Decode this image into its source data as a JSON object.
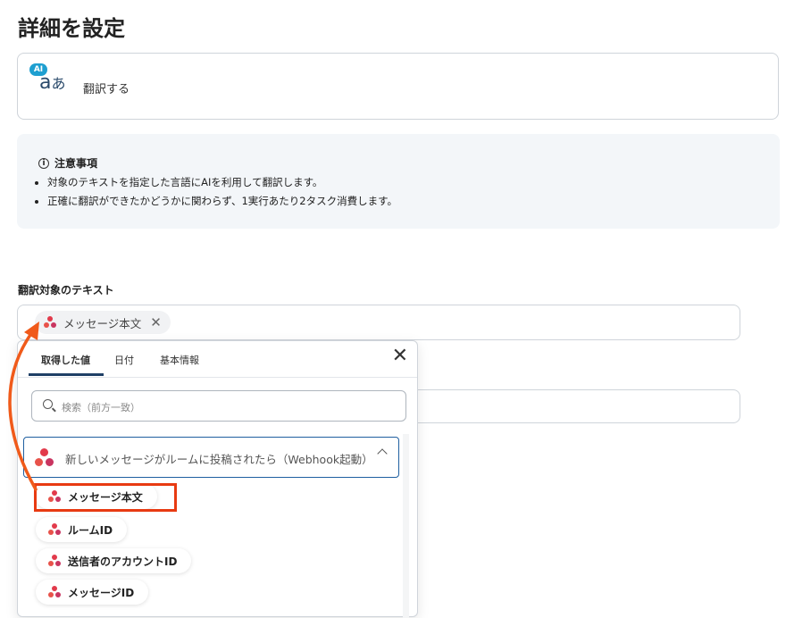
{
  "page_title": "詳細を設定",
  "action": {
    "badge": "AI",
    "glyph_a": "a",
    "glyph_kana": "あ",
    "label": "翻訳する"
  },
  "notice": {
    "title": "注意事項",
    "items": [
      "対象のテキストを指定した言語にAIを利用して翻訳します。",
      "正確に翻訳ができたかどうかに関わらず、1実行あたり2タスク消費します。"
    ]
  },
  "field": {
    "label": "翻訳対象のテキスト",
    "chip": "メッセージ本文"
  },
  "popup": {
    "tabs": [
      "取得した値",
      "日付",
      "基本情報"
    ],
    "search_placeholder": "検索（前方一致）",
    "group_label": "新しいメッセージがルームに投稿されたら（Webhook起動）",
    "items": [
      "メッセージ本文",
      "ルームID",
      "送信者のアカウントID",
      "メッセージID"
    ]
  },
  "colors": {
    "highlight": "#e83a12",
    "arrow": "#f05a1a",
    "accent": "#1f3f66"
  },
  "icons": [
    "ai-translate-icon",
    "info-icon",
    "close-icon",
    "search-icon",
    "chevron-up-icon",
    "chatwork-dots-icon"
  ]
}
